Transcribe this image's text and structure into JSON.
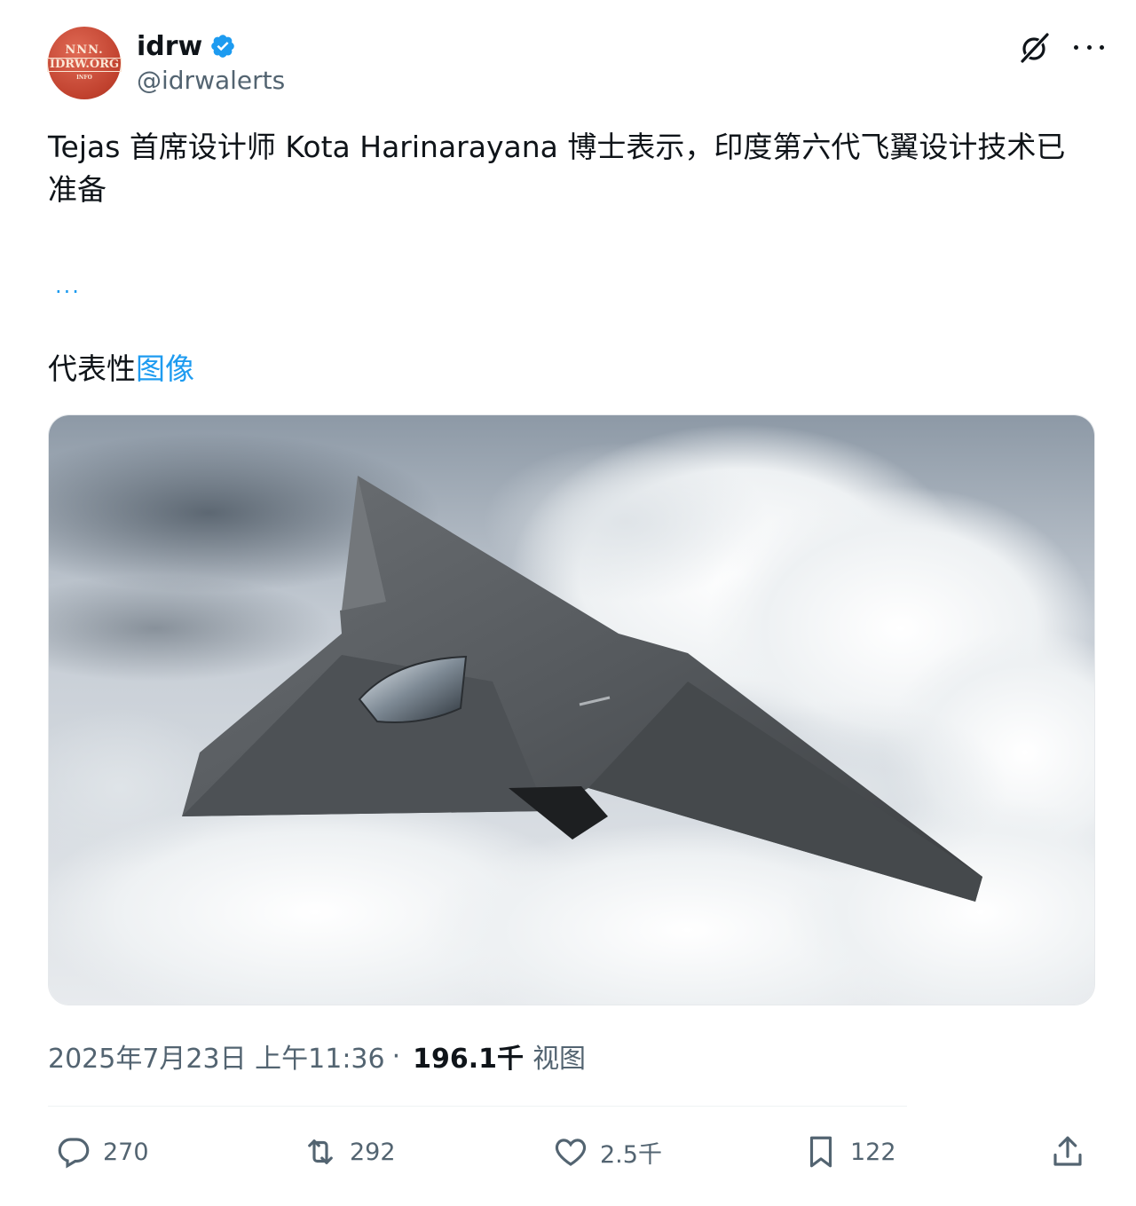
{
  "author": {
    "display_name": "idrw",
    "handle": "@idrwalerts",
    "avatar": {
      "line1": "NNN.",
      "line2": "IDRW.ORG",
      "line3": "INFO"
    },
    "verified_icon": "verified-badge-icon"
  },
  "header_icons": {
    "grok": "grok-icon",
    "more": "more-icon"
  },
  "tweet": {
    "text": "Tejas 首席设计师 Kota Harinarayana 博士表示，印度第六代飞翼设计技术已准备",
    "ellipsis": "...",
    "caption_plain": "代表性",
    "caption_link": "图像"
  },
  "meta": {
    "timestamp": "2025年7月23日 上午11:36",
    "separator": "·",
    "views_count": "196.1千",
    "views_label": "视图"
  },
  "actions": {
    "replies": "270",
    "retweets": "292",
    "likes": "2.5千",
    "bookmarks": "122"
  },
  "colors": {
    "accent": "#1d9bf0",
    "muted": "#536471",
    "text": "#0f1419"
  }
}
